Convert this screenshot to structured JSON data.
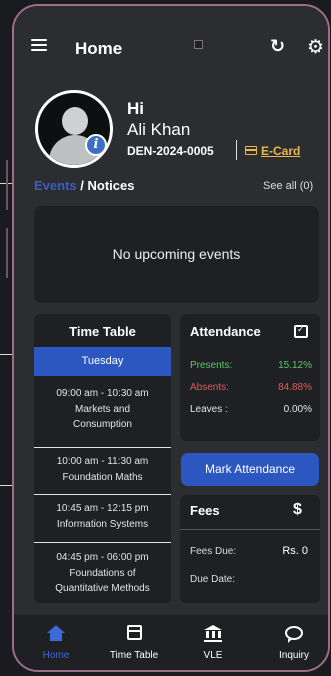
{
  "header": {
    "title": "Home"
  },
  "profile": {
    "greeting": "Hi",
    "name": "Ali Khan",
    "id": "DEN-2024-0005",
    "ecard_label": "E-Card"
  },
  "events": {
    "tab_events": "Events",
    "tab_separator": "/",
    "tab_notices": "Notices",
    "see_all": "See all (0)",
    "empty_message": "No upcoming events"
  },
  "timetable": {
    "title": "Time Table",
    "day": "Tuesday",
    "entries": [
      {
        "time": "09:00 am - 10:30 am",
        "subject": "Markets and Consumption"
      },
      {
        "time": "10:00 am - 11:30 am",
        "subject": "Foundation Maths"
      },
      {
        "time": "10:45 am - 12:15 pm",
        "subject": "Information Systems"
      },
      {
        "time": "04:45 pm - 06:00 pm",
        "subject": "Foundations of Quantitative Methods"
      }
    ]
  },
  "attendance": {
    "title": "Attendance",
    "presents_label": "Presents:",
    "presents_value": "15.12%",
    "absents_label": "Absents:",
    "absents_value": "84.88%",
    "leaves_label": "Leaves :",
    "leaves_value": "0.00%",
    "button_label": "Mark Attendance"
  },
  "fees": {
    "title": "Fees",
    "currency_symbol": "$",
    "due_label": "Fees Due:",
    "due_value": "Rs. 0",
    "date_label": "Due Date:"
  },
  "nav": [
    {
      "label": "Home",
      "icon": "home-icon"
    },
    {
      "label": "Time Table",
      "icon": "calendar-icon"
    },
    {
      "label": "VLE",
      "icon": "bank-icon"
    },
    {
      "label": "Inquiry",
      "icon": "chat-icon"
    }
  ],
  "colors": {
    "accent": "#2d57c0",
    "present": "#5cc86a",
    "absent": "#e05a5a",
    "ecard": "#e8b84a",
    "frame": "#9c6f86"
  }
}
